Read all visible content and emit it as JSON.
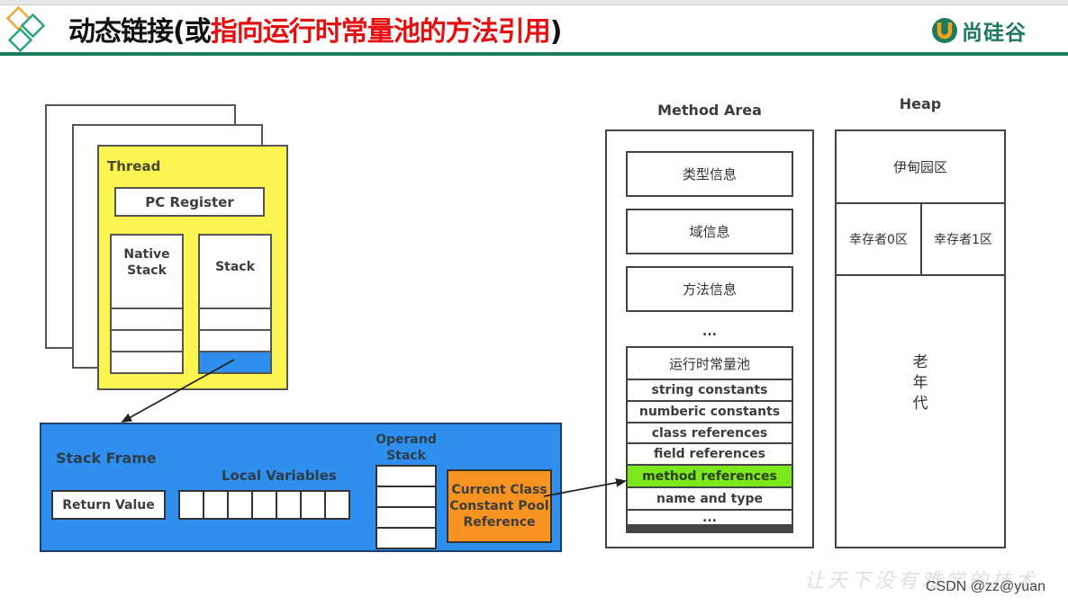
{
  "header": {
    "title_black_prefix": "动态链接(或",
    "title_red": "指向运行时常量池的方法引用",
    "title_black_suffix": ")",
    "logo_text": "尚硅谷",
    "logo_icon": "u-logo-icon",
    "corner_icon": "diamonds-icon",
    "colors": {
      "accent_green": "#1e7a5e",
      "title_red": "#e41010",
      "logo_orange": "#f4a21b"
    }
  },
  "thread": {
    "label": "Thread",
    "pc_register": "PC Register",
    "native_stack": "Native\nStack",
    "stack": "Stack",
    "color": "#fbf552"
  },
  "stack_frame": {
    "label": "Stack Frame",
    "return_value": "Return Value",
    "local_variables": "Local Variables",
    "local_variable_slots": 7,
    "operand_stack": "Operand\nStack",
    "operand_stack_slots": 4,
    "current_class_ref": "Current Class\nConstant Pool\nReference",
    "color": "#2e8fef",
    "ref_color": "#f79320"
  },
  "method_area": {
    "label": "Method Area",
    "items": [
      "类型信息",
      "域信息",
      "方法信息"
    ],
    "ellipsis": "...",
    "runtime_constant_pool": {
      "title": "运行时常量池",
      "rows": [
        "string constants",
        "numberic constants",
        "class references",
        "field references",
        "method references",
        "name and type",
        "..."
      ],
      "highlighted": "method references",
      "highlight_color": "#7ae81a"
    }
  },
  "heap": {
    "label": "Heap",
    "eden": "伊甸园区",
    "survivor0": "幸存者0区",
    "survivor1": "幸存者1区",
    "old_gen": "老\n年\n代"
  },
  "footer": {
    "watermark": "让天下没有难学的技术",
    "csdn": "CSDN @zz@yuan"
  }
}
